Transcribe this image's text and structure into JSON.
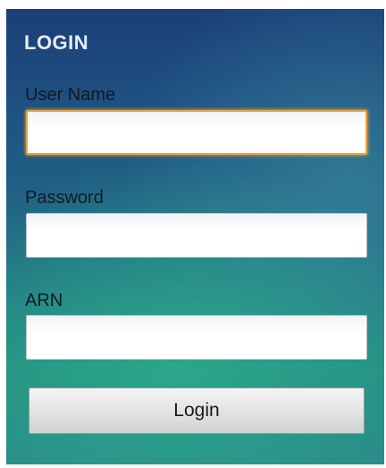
{
  "form": {
    "title": "LOGIN",
    "username": {
      "label": "User Name",
      "value": "",
      "focused": true
    },
    "password": {
      "label": "Password",
      "value": ""
    },
    "arn": {
      "label": "ARN",
      "value": ""
    },
    "submit_label": "Login"
  },
  "colors": {
    "focus_border": "#f0a13a",
    "title_text": "#e6ecf5",
    "label_text": "#111a22"
  }
}
